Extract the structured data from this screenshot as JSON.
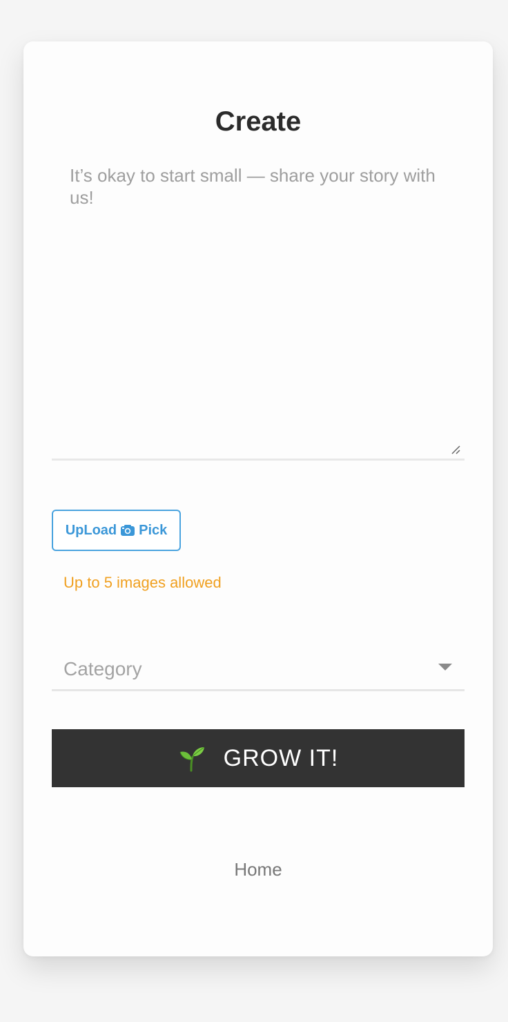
{
  "page": {
    "title": "Create"
  },
  "story": {
    "placeholder": "It’s okay to start small — share your story with us!",
    "value": ""
  },
  "upload": {
    "label_left": "UpLoad",
    "icon": "camera-icon",
    "label_right": "Pick",
    "note": "Up to 5 images allowed"
  },
  "category": {
    "placeholder": "Category",
    "icon": "chevron-down-icon"
  },
  "submit": {
    "icon": "sprout-icon",
    "label": "GROW IT!"
  },
  "footer": {
    "home_label": "Home"
  },
  "colors": {
    "accent_blue": "#3b97d8",
    "note_orange": "#f0a020",
    "button_dark": "#333333",
    "page_background": "#f5f5f5"
  }
}
